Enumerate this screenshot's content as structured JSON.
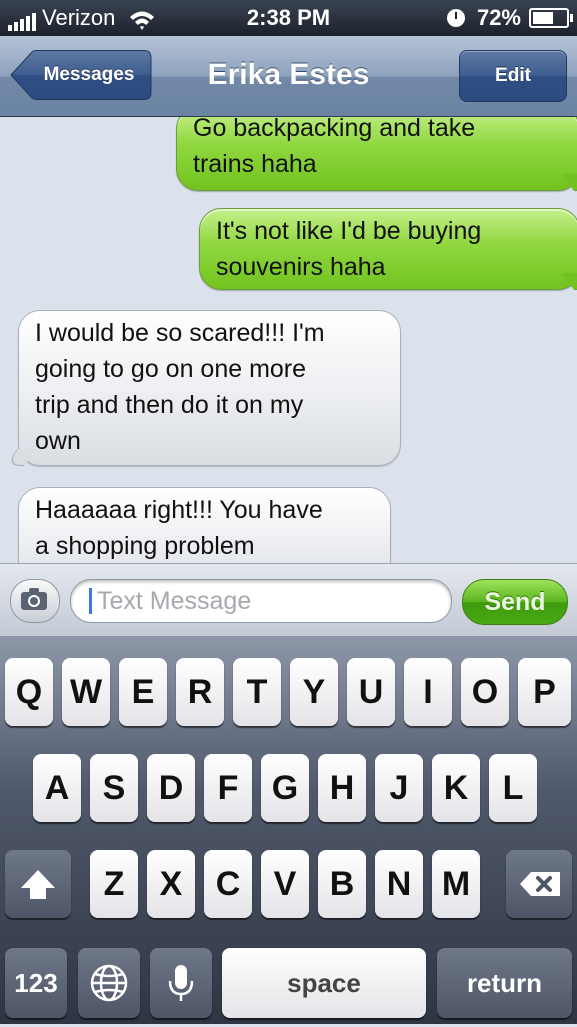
{
  "status_bar": {
    "carrier": "Verizon",
    "time": "2:38 PM",
    "battery": "72%",
    "battery_level": 0.72
  },
  "nav": {
    "back_label": "Messages",
    "title": "Erika Estes",
    "edit_label": "Edit"
  },
  "messages": [
    {
      "direction": "sent",
      "lines": [
        "Go backpacking and take",
        "trains haha"
      ]
    },
    {
      "direction": "sent",
      "lines": [
        "It's not like I'd be buying",
        "souvenirs haha"
      ]
    },
    {
      "direction": "received",
      "lines": [
        "I would be so scared!!! I'm",
        "going to go on one more",
        "trip and then do it on my",
        "own"
      ]
    },
    {
      "direction": "received",
      "lines": [
        "Haaaaaa right!!! You have",
        "a shopping problem"
      ]
    }
  ],
  "input": {
    "placeholder": "Text Message",
    "send_label": "Send",
    "camera_icon": "camera-icon"
  },
  "keyboard": {
    "row1": [
      "Q",
      "W",
      "E",
      "R",
      "T",
      "Y",
      "U",
      "I",
      "O",
      "P"
    ],
    "row2": [
      "A",
      "S",
      "D",
      "F",
      "G",
      "H",
      "J",
      "K",
      "L"
    ],
    "row3": [
      "Z",
      "X",
      "C",
      "V",
      "B",
      "N",
      "M"
    ],
    "shift_icon": "shift-arrow-icon",
    "delete_icon": "backspace-icon",
    "numbers_label": "123",
    "globe_icon": "globe-icon",
    "mic_icon": "microphone-icon",
    "space_label": "space",
    "return_label": "return"
  },
  "colors": {
    "sent_bubble": "#8fd73f",
    "received_bubble": "#ffffff",
    "send_button": "#5cb51f",
    "nav_bar": "#8ea2bd"
  }
}
